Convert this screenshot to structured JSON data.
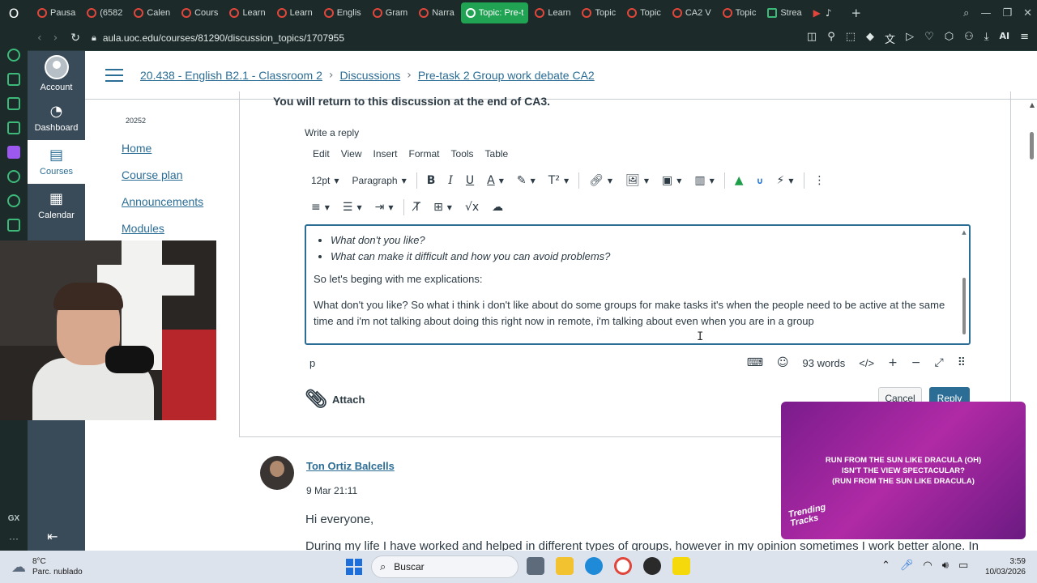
{
  "browser": {
    "tabs": [
      {
        "label": "Pausa",
        "active": false
      },
      {
        "label": "(6582",
        "active": false
      },
      {
        "label": "Calen",
        "active": false
      },
      {
        "label": "Cours",
        "active": false
      },
      {
        "label": "Learn",
        "active": false
      },
      {
        "label": "Learn",
        "active": false
      },
      {
        "label": "Englis",
        "active": false
      },
      {
        "label": "Gram",
        "active": false
      },
      {
        "label": "Narra",
        "active": false
      },
      {
        "label": "Topic: Pre-t",
        "active": true
      },
      {
        "label": "Learn",
        "active": false
      },
      {
        "label": "Topic",
        "active": false
      },
      {
        "label": "Topic",
        "active": false
      },
      {
        "label": "CA2 V",
        "active": false
      },
      {
        "label": "Topic",
        "active": false
      },
      {
        "label": "Strea",
        "active": false
      }
    ],
    "url": "aula.uoc.edu/courses/81290/discussion_topics/1707955",
    "ai_label": "AI",
    "sidebar_label": "GX"
  },
  "global_nav": {
    "items": [
      {
        "label": "Account",
        "icon": "account-avatar"
      },
      {
        "label": "Dashboard",
        "icon": "dashboard-icon"
      },
      {
        "label": "Courses",
        "icon": "courses-icon"
      },
      {
        "label": "Calendar",
        "icon": "calendar-icon"
      }
    ]
  },
  "breadcrumb": {
    "course": "20.438 - English B2.1 - Classroom 2",
    "section": "Discussions",
    "topic": "Pre-task 2 Group work debate CA2"
  },
  "course_nav": {
    "term": "20252",
    "links": [
      "Home",
      "Course plan",
      "Announcements",
      "Modules"
    ]
  },
  "discussion": {
    "cut_text": "You will return to this discussion at the end of CA3.",
    "write_reply": "Write a reply",
    "menubar": [
      "Edit",
      "View",
      "Insert",
      "Format",
      "Tools",
      "Table"
    ],
    "font_size": "12pt",
    "block_format": "Paragraph",
    "editor": {
      "bullets": [
        "What don't you like?",
        "What can make it difficult and how you can avoid problems?"
      ],
      "p1": "So let's beging with me explications:",
      "p2": "What don't you like?  So what i think i don't like about do some groups for make tasks it's when the people need to be active at the same time and i'm not talking about doing this right now in remote, i'm talking about even when you are in a group"
    },
    "status_path": "p",
    "word_count": "93 words",
    "html_toggle": "</>",
    "attach_label": "Attach",
    "cancel_label": "Cancel",
    "reply_label": "Reply"
  },
  "entry": {
    "author": "Ton Ortiz Balcells",
    "date": "9 Mar 21:11",
    "greeting": "Hi everyone,",
    "body": "During my life I have worked and helped in different types of groups, however in my opinion sometimes I work better alone. In"
  },
  "music_overlay": {
    "lyrics_1": "RUN FROM THE SUN LIKE DRACULA (OH)",
    "lyrics_2": "ISN'T THE VIEW SPECTACULAR?",
    "lyrics_3": "(RUN FROM THE SUN LIKE DRACULA)",
    "brand_1": "Trending",
    "brand_2": "Tracks"
  },
  "taskbar": {
    "temp": "8°C",
    "weather": "Parc. nublado",
    "search_placeholder": "Buscar",
    "time": "3:59",
    "date": "10/03/2026"
  }
}
